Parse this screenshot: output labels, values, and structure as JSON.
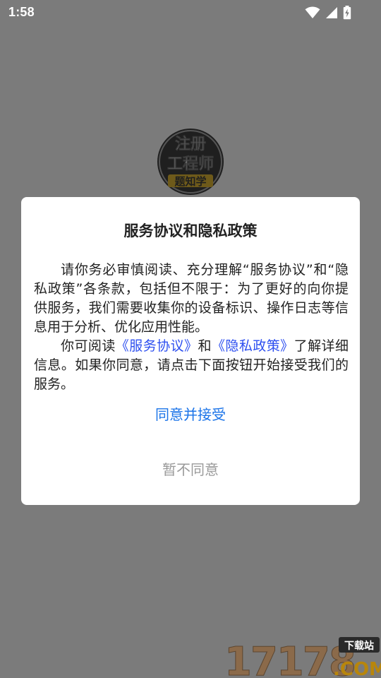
{
  "status_bar": {
    "time": "1:58",
    "icons": [
      "wifi-icon",
      "cellular-signal-icon",
      "battery-charging-icon"
    ]
  },
  "background": {
    "logo_text": [
      "注册",
      "工程师",
      "题知学"
    ],
    "logo_icon": "app-logo"
  },
  "dialog": {
    "title": "服务协议和隐私政策",
    "paragraph1": "请你务必审慎阅读、充分理解“服务协议”和“隐私政策”各条款，包括但不限于：为了更好的向你提供服务，我们需要收集你的设备标识、操作日志等信息用于分析、优化应用性能。",
    "paragraph2_prefix": "你可阅读",
    "service_agreement_link": "《服务协议》",
    "paragraph2_and": "和",
    "privacy_policy_link": "《隐私政策》",
    "paragraph2_suffix": "了解详细信息。如果你同意，请点击下面按钮开始接受我们的服务。",
    "accept_label": "同意并接受",
    "reject_label": "暂不同意"
  },
  "watermark": {
    "number": "17178",
    "badge": "下载站",
    "domain": ".COM"
  },
  "colors": {
    "scrim": "#7b7b7b",
    "dialog_bg": "#ffffff",
    "accept": "#1a73e8",
    "link": "#2d4ff0",
    "reject": "#9a9a9a"
  }
}
